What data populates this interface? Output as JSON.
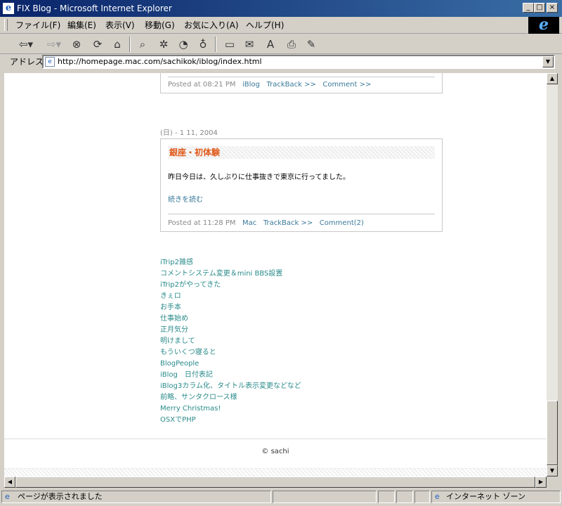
{
  "window": {
    "title": "FIX Blog - Microsoft Internet Explorer"
  },
  "menu": [
    "ファイル(F)",
    "編集(E)",
    "表示(V)",
    "移動(G)",
    "お気に入り(A)",
    "ヘルプ(H)"
  ],
  "address": {
    "label": "アドレス",
    "url": "http://homepage.mac.com/sachikok/iblog/index.html"
  },
  "prev_entry": {
    "posted": "Posted at 08:21 PM",
    "category": "iBlog",
    "trackback": "TrackBack >>",
    "comment": "Comment >>"
  },
  "entry": {
    "date": "(日) - 1 11, 2004",
    "title": "銀座・初体験",
    "body": "昨日今日は、久しぶりに仕事抜きで東京に行ってました。",
    "read_more": "続きを読む",
    "posted": "Posted at 11:28 PM",
    "category": "Mac",
    "trackback": "TrackBack >>",
    "comment": "Comment(2)"
  },
  "recent_entries": [
    "iTrip2雑感",
    "コメントシステム変更＆mini BBS設置",
    "iTrip2がやってきた",
    "きぇロ",
    "お手本",
    "仕事始め",
    "正月気分",
    "明けまして",
    "もういくつ寝ると",
    "BlogPeople",
    "iBlog　日付表記",
    "iBlog3カラム化、タイトル表示変更などなど",
    "前略、サンタクロース様",
    "Merry Christmas!",
    "OSXでPHP"
  ],
  "footer": {
    "copyright": "© sachi"
  },
  "status": {
    "text": "ページが表示されました",
    "zone": "インターネット ゾーン"
  },
  "icons": {
    "back": "back-arrow-icon",
    "forward": "forward-arrow-icon",
    "stop": "stop-icon",
    "refresh": "refresh-icon",
    "home": "home-icon"
  }
}
